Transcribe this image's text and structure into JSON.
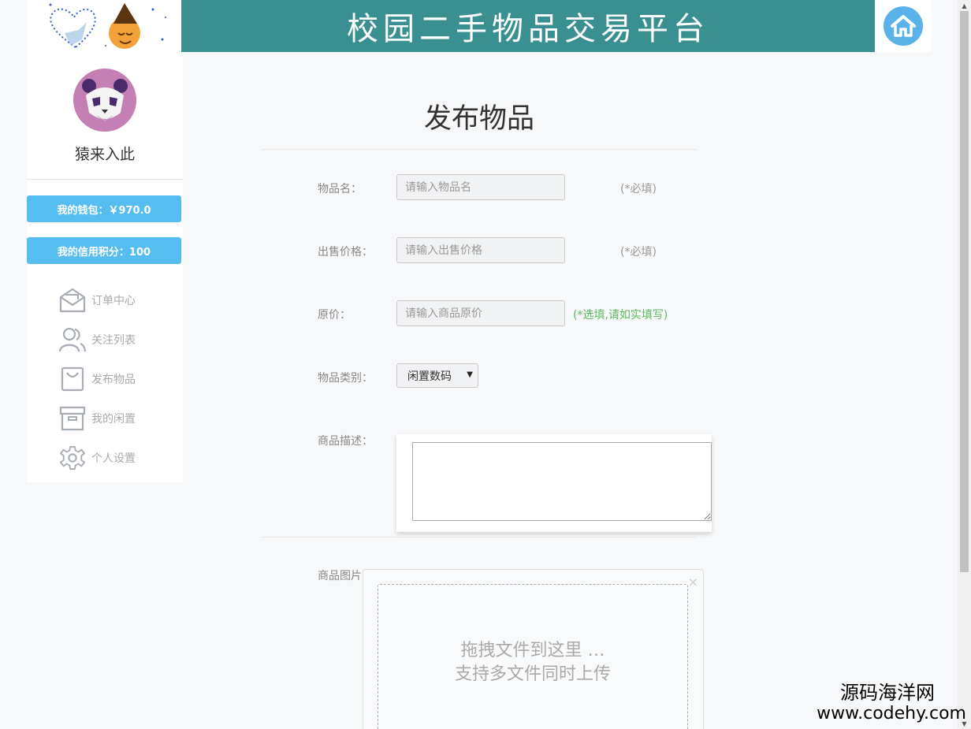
{
  "header": {
    "title": "校园二手物品交易平台"
  },
  "sidebar": {
    "username": "猿来入此",
    "wallet_label": "我的钱包：￥970.0",
    "credit_label": "我的信用积分：100",
    "menu": [
      {
        "label": "订单中心",
        "icon": "envelope-icon"
      },
      {
        "label": "关注列表",
        "icon": "users-icon"
      },
      {
        "label": "发布物品",
        "icon": "shopping-bag-icon"
      },
      {
        "label": "我的闲置",
        "icon": "archive-box-icon"
      },
      {
        "label": "个人设置",
        "icon": "gear-icon"
      }
    ]
  },
  "form": {
    "title": "发布物品",
    "name": {
      "label": "物品名：",
      "placeholder": "请输入物品名",
      "note": "(*必填)"
    },
    "price": {
      "label": "出售价格：",
      "placeholder": "请输入出售价格",
      "note": "(*必填)"
    },
    "original_price": {
      "label": "原价：",
      "placeholder": "请输入商品原价",
      "note": "(*选填,请如实填写)"
    },
    "category": {
      "label": "物品类别：",
      "selected": "闲置数码"
    },
    "description": {
      "label": "商品描述：",
      "value": ""
    },
    "images": {
      "label": "商品图片：",
      "drop_line1": "拖拽文件到这里 …",
      "drop_line2": "支持多文件同时上传",
      "close_symbol": "×"
    }
  },
  "watermark": {
    "name": "源码海洋网",
    "url": "www.codehy.com"
  },
  "colors": {
    "header_bg": "#3a9090",
    "stat_button": "#56bdf1",
    "optional_note": "#5cb85c",
    "home_button": "#5ab3e8"
  }
}
